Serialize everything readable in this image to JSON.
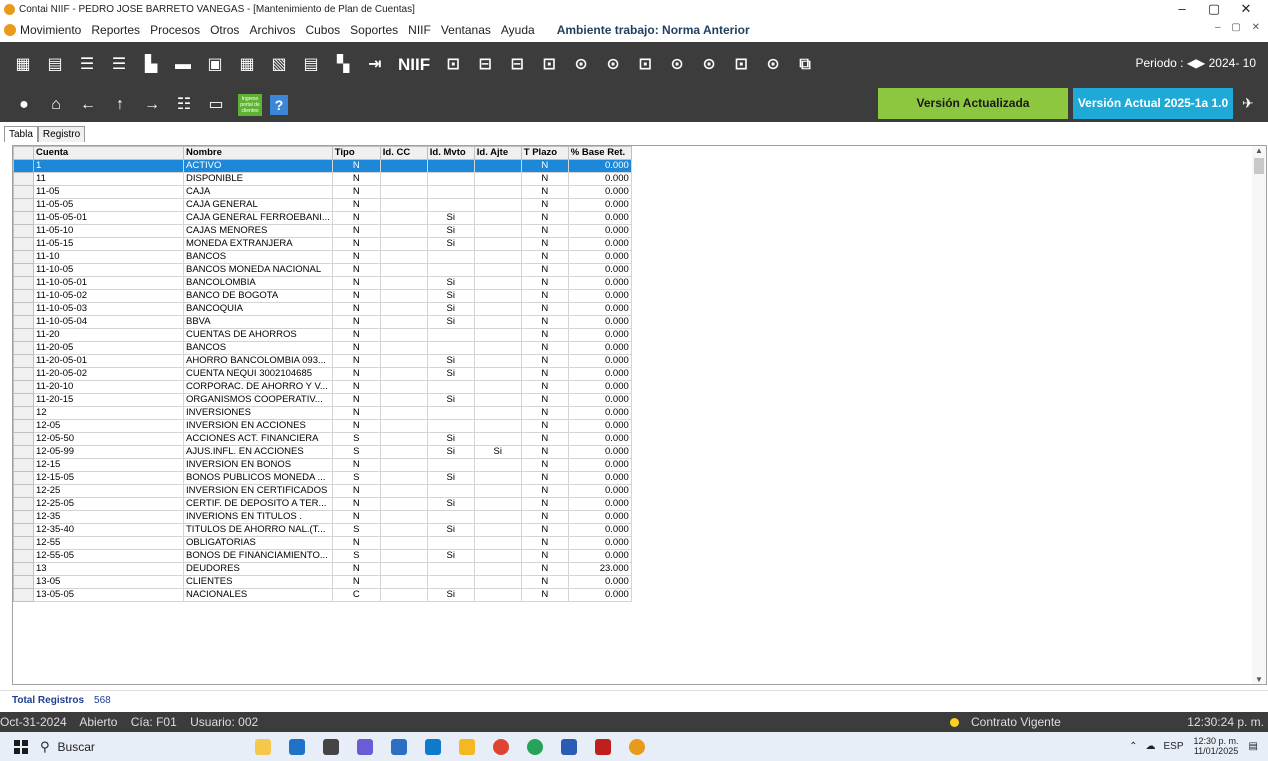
{
  "window": {
    "title": "Contai NIIF - PEDRO JOSE BARRETO VANEGAS - [Mantenimiento de Plan de Cuentas]",
    "min": "–",
    "max": "▢",
    "close": "✕"
  },
  "menu": {
    "items": [
      "Movimiento",
      "Reportes",
      "Procesos",
      "Otros",
      "Archivos",
      "Cubos",
      "Soportes",
      "NIIF",
      "Ventanas",
      "Ayuda"
    ],
    "environment": "Ambiente trabajo: Norma Anterior",
    "mdi_controls": "– ▢ ✕"
  },
  "toolbar": {
    "niif_label": "NIIF",
    "periodo_label": "Periodo : ◀▶  2024- 10"
  },
  "toolbar2": {
    "portal_label": "Ingreso portal de clientes",
    "help": "?"
  },
  "badges": {
    "actualizada": "Versión Actualizada",
    "actual": "Versión Actual 2025-1a 1.0"
  },
  "tabs": {
    "tabla": "Tabla",
    "registro": "Registro"
  },
  "table": {
    "headers": [
      "Cuenta",
      "Nombre",
      "Tipo",
      "Id. CC",
      "Id. Mvto",
      "Id. Ajte",
      "T Plazo",
      "% Base Ret."
    ],
    "rows": [
      [
        "1",
        "ACTIVO",
        "N",
        "",
        "",
        "",
        "N",
        "0.000"
      ],
      [
        "11",
        "DISPONIBLE",
        "N",
        "",
        "",
        "",
        "N",
        "0.000"
      ],
      [
        "11-05",
        "CAJA",
        "N",
        "",
        "",
        "",
        "N",
        "0.000"
      ],
      [
        "11-05-05",
        "CAJA GENERAL",
        "N",
        "",
        "",
        "",
        "N",
        "0.000"
      ],
      [
        "11-05-05-01",
        "CAJA GENERAL FERROEBANI...",
        "N",
        "",
        "Si",
        "",
        "N",
        "0.000"
      ],
      [
        "11-05-10",
        "CAJAS MENORES",
        "N",
        "",
        "Si",
        "",
        "N",
        "0.000"
      ],
      [
        "11-05-15",
        "MONEDA EXTRANJERA",
        "N",
        "",
        "Si",
        "",
        "N",
        "0.000"
      ],
      [
        "11-10",
        "BANCOS",
        "N",
        "",
        "",
        "",
        "N",
        "0.000"
      ],
      [
        "11-10-05",
        "BANCOS MONEDA NACIONAL",
        "N",
        "",
        "",
        "",
        "N",
        "0.000"
      ],
      [
        "11-10-05-01",
        "BANCOLOMBIA",
        "N",
        "",
        "Si",
        "",
        "N",
        "0.000"
      ],
      [
        "11-10-05-02",
        "BANCO DE BOGOTA",
        "N",
        "",
        "Si",
        "",
        "N",
        "0.000"
      ],
      [
        "11-10-05-03",
        "BANCOQUIA",
        "N",
        "",
        "Si",
        "",
        "N",
        "0.000"
      ],
      [
        "11-10-05-04",
        "BBVA",
        "N",
        "",
        "Si",
        "",
        "N",
        "0.000"
      ],
      [
        "11-20",
        "CUENTAS DE AHORROS",
        "N",
        "",
        "",
        "",
        "N",
        "0.000"
      ],
      [
        "11-20-05",
        "BANCOS",
        "N",
        "",
        "",
        "",
        "N",
        "0.000"
      ],
      [
        "11-20-05-01",
        "AHORRO BANCOLOMBIA 093...",
        "N",
        "",
        "Si",
        "",
        "N",
        "0.000"
      ],
      [
        "11-20-05-02",
        "CUENTA NEQUI 3002104685",
        "N",
        "",
        "Si",
        "",
        "N",
        "0.000"
      ],
      [
        "11-20-10",
        "CORPORAC. DE AHORRO Y V...",
        "N",
        "",
        "",
        "",
        "N",
        "0.000"
      ],
      [
        "11-20-15",
        "ORGANISMOS COOPERATIV...",
        "N",
        "",
        "Si",
        "",
        "N",
        "0.000"
      ],
      [
        "12",
        "INVERSIONES",
        "N",
        "",
        "",
        "",
        "N",
        "0.000"
      ],
      [
        "12-05",
        "INVERSION EN ACCIONES",
        "N",
        "",
        "",
        "",
        "N",
        "0.000"
      ],
      [
        "12-05-50",
        "ACCIONES ACT. FINANCIERA",
        "S",
        "",
        "Si",
        "",
        "N",
        "0.000"
      ],
      [
        "12-05-99",
        "AJUS.INFL. EN ACCIONES",
        "S",
        "",
        "Si",
        "Si",
        "N",
        "0.000"
      ],
      [
        "12-15",
        "INVERSION EN BONOS",
        "N",
        "",
        "",
        "",
        "N",
        "0.000"
      ],
      [
        "12-15-05",
        "BONOS PUBLICOS MONEDA ...",
        "S",
        "",
        "Si",
        "",
        "N",
        "0.000"
      ],
      [
        "12-25",
        "INVERSION EN CERTIFICADOS",
        "N",
        "",
        "",
        "",
        "N",
        "0.000"
      ],
      [
        "12-25-05",
        "CERTIF. DE DEPOSITO A TER...",
        "N",
        "",
        "Si",
        "",
        "N",
        "0.000"
      ],
      [
        "12-35",
        "INVERIONS EN TITULOS       .",
        "N",
        "",
        "",
        "",
        "N",
        "0.000"
      ],
      [
        "12-35-40",
        "TITULOS DE AHORRO NAL.(T...",
        "S",
        "",
        "Si",
        "",
        "N",
        "0.000"
      ],
      [
        "12-55",
        "OBLIGATORIAS",
        "N",
        "",
        "",
        "",
        "N",
        "0.000"
      ],
      [
        "12-55-05",
        "BONOS DE FINANCIAMIENTO...",
        "S",
        "",
        "Si",
        "",
        "N",
        "0.000"
      ],
      [
        "13",
        "DEUDORES",
        "N",
        "",
        "",
        "",
        "N",
        "23.000"
      ],
      [
        "13-05",
        "CLIENTES",
        "N",
        "",
        "",
        "",
        "N",
        "0.000"
      ],
      [
        "13-05-05",
        "NACIONALES",
        "C",
        "",
        "Si",
        "",
        "N",
        "0.000"
      ]
    ]
  },
  "footer": {
    "total_label": "Total Registros",
    "total_value": "568"
  },
  "status": {
    "date": "Oct-31-2024",
    "state": "Abierto",
    "cia": "Cía: F01",
    "user": "Usuario: 002",
    "contract": "Contrato Vigente",
    "clock": "12:30:24 p. m."
  },
  "taskbar": {
    "search": "Buscar",
    "lang": "ESP",
    "time": "12:30 p. m.",
    "date": "11/01/2025"
  }
}
